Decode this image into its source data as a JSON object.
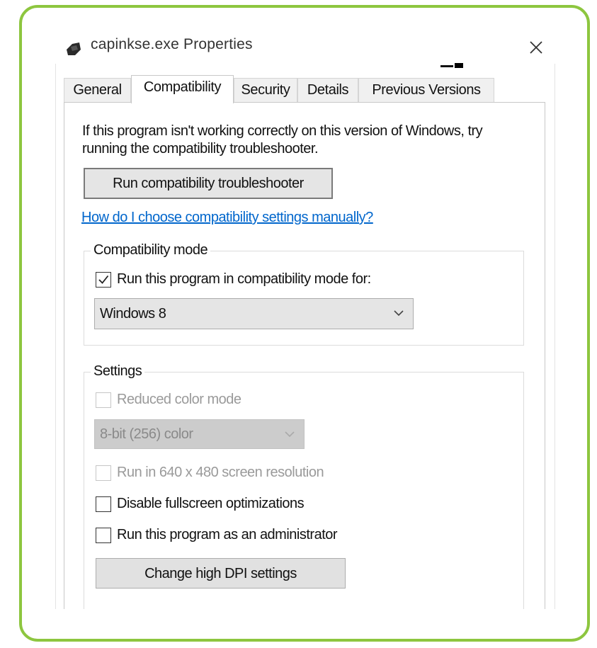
{
  "window": {
    "title": "capinkse.exe Properties",
    "close_icon": "close-icon",
    "app_icon": "program-icon"
  },
  "tabs": [
    {
      "label": "General",
      "active": false
    },
    {
      "label": "Compatibility",
      "active": true
    },
    {
      "label": "Security",
      "active": false
    },
    {
      "label": "Details",
      "active": false
    },
    {
      "label": "Previous Versions",
      "active": false
    }
  ],
  "compatibility": {
    "intro": "If this program isn't working correctly on this version of Windows, try running the compatibility troubleshooter.",
    "troubleshooter_button": "Run compatibility troubleshooter",
    "help_link": "How do I choose compatibility settings manually?",
    "mode_group": {
      "legend": "Compatibility mode",
      "checkbox_label": "Run this program in compatibility mode for:",
      "checked": true,
      "selected_os": "Windows 8"
    },
    "settings_group": {
      "legend": "Settings",
      "reduced_color_label": "Reduced color mode",
      "color_depth": "8-bit (256) color",
      "resolution_label": "Run in 640 x 480 screen resolution",
      "fullscreen_label": "Disable fullscreen optimizations",
      "admin_label": "Run this program as an administrator",
      "dpi_button": "Change high DPI settings"
    }
  },
  "colors": {
    "frame_border": "#8dc63f",
    "link": "#0066cc",
    "disabled_text": "#9a9a9a"
  }
}
